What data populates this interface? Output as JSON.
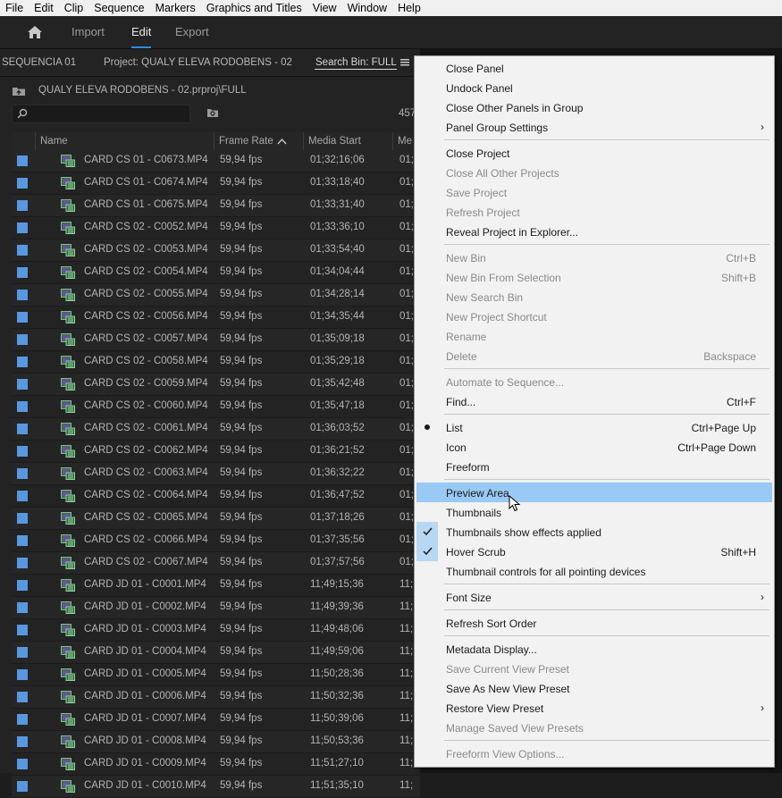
{
  "menubar": [
    "File",
    "Edit",
    "Clip",
    "Sequence",
    "Markers",
    "Graphics and Titles",
    "View",
    "Window",
    "Help"
  ],
  "workspace": {
    "import": "Import",
    "edit": "Edit",
    "export": "Export"
  },
  "panel": {
    "sequence_tab": "SEQUENCIA 01",
    "project_tab": "Project: QUALY ELEVA RODOBENS - 02",
    "search_bin_tab": "Search Bin: FULL",
    "path": "QUALY ELEVA RODOBENS - 02.prproj\\FULL",
    "item_count": "457",
    "columns": {
      "name": "Name",
      "frame_rate": "Frame Rate",
      "media_start": "Media Start",
      "media_end": "Me"
    },
    "rows": [
      {
        "name": "CARD CS 01 - C0673.MP4",
        "fps": "59,94 fps",
        "start": "01;32;16;06",
        "end": "01;"
      },
      {
        "name": "CARD CS 01 - C0674.MP4",
        "fps": "59,94 fps",
        "start": "01;33;18;40",
        "end": "01;"
      },
      {
        "name": "CARD CS 01 - C0675.MP4",
        "fps": "59,94 fps",
        "start": "01;33;31;40",
        "end": "01;"
      },
      {
        "name": "CARD CS 02 - C0052.MP4",
        "fps": "59,94 fps",
        "start": "01;33;36;10",
        "end": "01;"
      },
      {
        "name": "CARD CS 02 - C0053.MP4",
        "fps": "59,94 fps",
        "start": "01;33;54;40",
        "end": "01;"
      },
      {
        "name": "CARD CS 02 - C0054.MP4",
        "fps": "59,94 fps",
        "start": "01;34;04;44",
        "end": "01;"
      },
      {
        "name": "CARD CS 02 - C0055.MP4",
        "fps": "59,94 fps",
        "start": "01;34;28;14",
        "end": "01;"
      },
      {
        "name": "CARD CS 02 - C0056.MP4",
        "fps": "59,94 fps",
        "start": "01;34;35;44",
        "end": "01;"
      },
      {
        "name": "CARD CS 02 - C0057.MP4",
        "fps": "59,94 fps",
        "start": "01;35;09;18",
        "end": "01;"
      },
      {
        "name": "CARD CS 02 - C0058.MP4",
        "fps": "59,94 fps",
        "start": "01;35;29;18",
        "end": "01;"
      },
      {
        "name": "CARD CS 02 - C0059.MP4",
        "fps": "59,94 fps",
        "start": "01;35;42;48",
        "end": "01;"
      },
      {
        "name": "CARD CS 02 - C0060.MP4",
        "fps": "59,94 fps",
        "start": "01;35;47;18",
        "end": "01;"
      },
      {
        "name": "CARD CS 02 - C0061.MP4",
        "fps": "59,94 fps",
        "start": "01;36;03;52",
        "end": "01;"
      },
      {
        "name": "CARD CS 02 - C0062.MP4",
        "fps": "59,94 fps",
        "start": "01;36;21;52",
        "end": "01;"
      },
      {
        "name": "CARD CS 02 - C0063.MP4",
        "fps": "59,94 fps",
        "start": "01;36;32;22",
        "end": "01;"
      },
      {
        "name": "CARD CS 02 - C0064.MP4",
        "fps": "59,94 fps",
        "start": "01;36;47;52",
        "end": "01;"
      },
      {
        "name": "CARD CS 02 - C0065.MP4",
        "fps": "59,94 fps",
        "start": "01;37;18;26",
        "end": "01;"
      },
      {
        "name": "CARD CS 02 - C0066.MP4",
        "fps": "59,94 fps",
        "start": "01;37;35;56",
        "end": "01;"
      },
      {
        "name": "CARD CS 02 - C0067.MP4",
        "fps": "59,94 fps",
        "start": "01;37;57;56",
        "end": "01;"
      },
      {
        "name": "CARD JD 01 - C0001.MP4",
        "fps": "59,94 fps",
        "start": "11;49;15;36",
        "end": "11;"
      },
      {
        "name": "CARD JD 01 - C0002.MP4",
        "fps": "59,94 fps",
        "start": "11;49;39;36",
        "end": "11;"
      },
      {
        "name": "CARD JD 01 - C0003.MP4",
        "fps": "59,94 fps",
        "start": "11;49;48;06",
        "end": "11;"
      },
      {
        "name": "CARD JD 01 - C0004.MP4",
        "fps": "59,94 fps",
        "start": "11;49;59;06",
        "end": "11;"
      },
      {
        "name": "CARD JD 01 - C0005.MP4",
        "fps": "59,94 fps",
        "start": "11;50;28;36",
        "end": "11;"
      },
      {
        "name": "CARD JD 01 - C0006.MP4",
        "fps": "59,94 fps",
        "start": "11;50;32;36",
        "end": "11;"
      },
      {
        "name": "CARD JD 01 - C0007.MP4",
        "fps": "59,94 fps",
        "start": "11;50;39;06",
        "end": "11;"
      },
      {
        "name": "CARD JD 01 - C0008.MP4",
        "fps": "59,94 fps",
        "start": "11;50;53;36",
        "end": "11;"
      },
      {
        "name": "CARD JD 01 - C0009.MP4",
        "fps": "59,94 fps",
        "start": "11;51;27;10",
        "end": "11;"
      },
      {
        "name": "CARD JD 01 - C0010.MP4",
        "fps": "59,94 fps",
        "start": "11;51;35;10",
        "end": "11;"
      }
    ]
  },
  "context_menu": {
    "items": [
      {
        "label": "Close Panel",
        "shortcut": "",
        "enabled": true
      },
      {
        "label": "Undock Panel",
        "shortcut": "",
        "enabled": true
      },
      {
        "label": "Close Other Panels in Group",
        "shortcut": "",
        "enabled": true
      },
      {
        "label": "Panel Group Settings",
        "shortcut": "",
        "enabled": true,
        "submenu": true
      },
      {
        "label": "Close Project",
        "shortcut": "",
        "enabled": true
      },
      {
        "label": "Close All Other Projects",
        "shortcut": "",
        "enabled": false
      },
      {
        "label": "Save Project",
        "shortcut": "",
        "enabled": false
      },
      {
        "label": "Refresh Project",
        "shortcut": "",
        "enabled": false
      },
      {
        "label": "Reveal Project in Explorer...",
        "shortcut": "",
        "enabled": true
      },
      {
        "label": "New Bin",
        "shortcut": "Ctrl+B",
        "enabled": false
      },
      {
        "label": "New Bin From Selection",
        "shortcut": "Shift+B",
        "enabled": false
      },
      {
        "label": "New Search Bin",
        "shortcut": "",
        "enabled": false
      },
      {
        "label": "New Project Shortcut",
        "shortcut": "",
        "enabled": false
      },
      {
        "label": "Rename",
        "shortcut": "",
        "enabled": false
      },
      {
        "label": "Delete",
        "shortcut": "Backspace",
        "enabled": false
      },
      {
        "label": "Automate to Sequence...",
        "shortcut": "",
        "enabled": false
      },
      {
        "label": "Find...",
        "shortcut": "Ctrl+F",
        "enabled": true
      },
      {
        "label": "List",
        "shortcut": "Ctrl+Page Up",
        "enabled": true,
        "radio": true
      },
      {
        "label": "Icon",
        "shortcut": "Ctrl+Page Down",
        "enabled": true
      },
      {
        "label": "Freeform",
        "shortcut": "",
        "enabled": true
      },
      {
        "label": "Preview Area",
        "shortcut": "",
        "enabled": true,
        "highlighted": true
      },
      {
        "label": "Thumbnails",
        "shortcut": "",
        "enabled": true
      },
      {
        "label": "Thumbnails show effects applied",
        "shortcut": "",
        "enabled": true,
        "checked": true
      },
      {
        "label": "Hover Scrub",
        "shortcut": "Shift+H",
        "enabled": true,
        "checked": true
      },
      {
        "label": "Thumbnail controls for all pointing devices",
        "shortcut": "",
        "enabled": true
      },
      {
        "label": "Font Size",
        "shortcut": "",
        "enabled": true,
        "submenu": true
      },
      {
        "label": "Refresh Sort Order",
        "shortcut": "",
        "enabled": true
      },
      {
        "label": "Metadata Display...",
        "shortcut": "",
        "enabled": true
      },
      {
        "label": "Save Current View Preset",
        "shortcut": "",
        "enabled": false
      },
      {
        "label": "Save As New View Preset",
        "shortcut": "",
        "enabled": true
      },
      {
        "label": "Restore View Preset",
        "shortcut": "",
        "enabled": true,
        "submenu": true
      },
      {
        "label": "Manage Saved View Presets",
        "shortcut": "",
        "enabled": false
      },
      {
        "label": "Freeform View Options...",
        "shortcut": "",
        "enabled": false
      }
    ]
  }
}
